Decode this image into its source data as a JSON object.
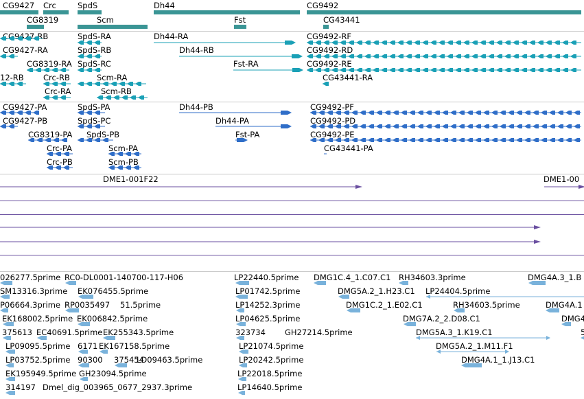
{
  "colors": {
    "gene": "#3a9595",
    "transcript": "#1aa0b6",
    "protein": "#2f6ec8",
    "clone": "#6a4fa0",
    "est": "#79b2db",
    "separator": "#c8c8c8"
  },
  "gene_labels": [
    "CG9427",
    "Crc",
    "SpdS",
    "Dh44",
    "CG9492",
    "CG8319",
    "Scm",
    "Fst",
    "CG43441"
  ],
  "transcript_labels": [
    "CG9427-RB",
    "SpdS-RA",
    "Dh44-RA",
    "CG9492-RF",
    "CG9427-RA",
    "SpdS-RB",
    "Dh44-RB",
    "CG9492-RD",
    "CG8319-RA",
    "SpdS-RC",
    "Fst-RA",
    "CG9492-RE",
    "12-RB",
    "Crc-RB",
    "Scm-RA",
    "CG43441-RA",
    "Crc-RA",
    "Scm-RB"
  ],
  "protein_labels": [
    "CG9427-PA",
    "SpdS-PA",
    "Dh44-PB",
    "CG9492-PF",
    "CG9427-PB",
    "SpdS-PC",
    "Dh44-PA",
    "CG9492-PD",
    "CG8319-PA",
    "SpdS-PB",
    "Fst-PA",
    "CG9492-PE",
    "Crc-PA",
    "Scm-PA",
    "CG43441-PA",
    "Crc-PB",
    "Scm-PB"
  ],
  "clone_labels": [
    "DME1-001F22",
    "DME1-00"
  ],
  "est_labels": [
    "026277.5prime",
    "RC0-DL0001-140700-117-H06",
    "LP22440.5prime",
    "DMG1C.4_1.C07.C1",
    "RH34603.3prime",
    "DMG4A.3_1.B",
    "SM13316.3prime",
    "EK076455.5prime",
    "LP01742.5prime",
    "DMG5A.2_1.H23.C1",
    "LP24404.5prime",
    "P06664.3prime",
    "RP0035497",
    "51.5prime",
    "LP14252.3prime",
    "DMG1C.2_1.E02.C1",
    "RH34603.5prime",
    "DMG4A.1",
    "EK168002.5prime",
    "EK006842.5prime",
    "LP04625.5prime",
    "DMG7A.2_2.D08.C1",
    "DMG4",
    "375613",
    "EC40691.5prime",
    "EK255343.5prime",
    "323734",
    "GH27214.5prime",
    "DMG5A.3_1.K19.C1",
    "5",
    "LP09095.5prime",
    "6171",
    "EK167158.5prime",
    "LP21074.5prime",
    "DMG5A.2_1.M11.F1",
    "LP03752.5prime",
    "90300",
    "375454",
    "LD09463.5prime",
    "LP20242.5prime",
    "DMG4A.1_1.J13.C1",
    "EK195949.5prime",
    "GH23094.5prime",
    "LP22018.5prime",
    "314197",
    "Dmel_dig_003965_0677_2937.3prime",
    "LP14640.5prime"
  ]
}
